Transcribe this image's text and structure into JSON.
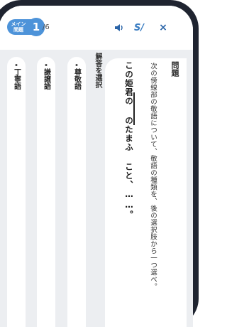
{
  "header": {
    "badge_label": "メイン\n問題",
    "question_number": "1",
    "question_total": "/6",
    "speaker_icon": "speaker-icon",
    "hint_label": "S/",
    "close_label": "×"
  },
  "question": {
    "title": "問題",
    "instruction": "次の傍線部の敬語について、敬語の種類を、後の選択肢から一つ選べ。",
    "sentence": "この姫君の のたまふ こと、……。"
  },
  "answers": {
    "heading": "解答を選択",
    "choices": [
      "尊敬語",
      "謙譲語",
      "丁寧語"
    ]
  },
  "colors": {
    "accent": "#4d93d9",
    "frame": "#1f2430",
    "background": "#eceef1"
  }
}
